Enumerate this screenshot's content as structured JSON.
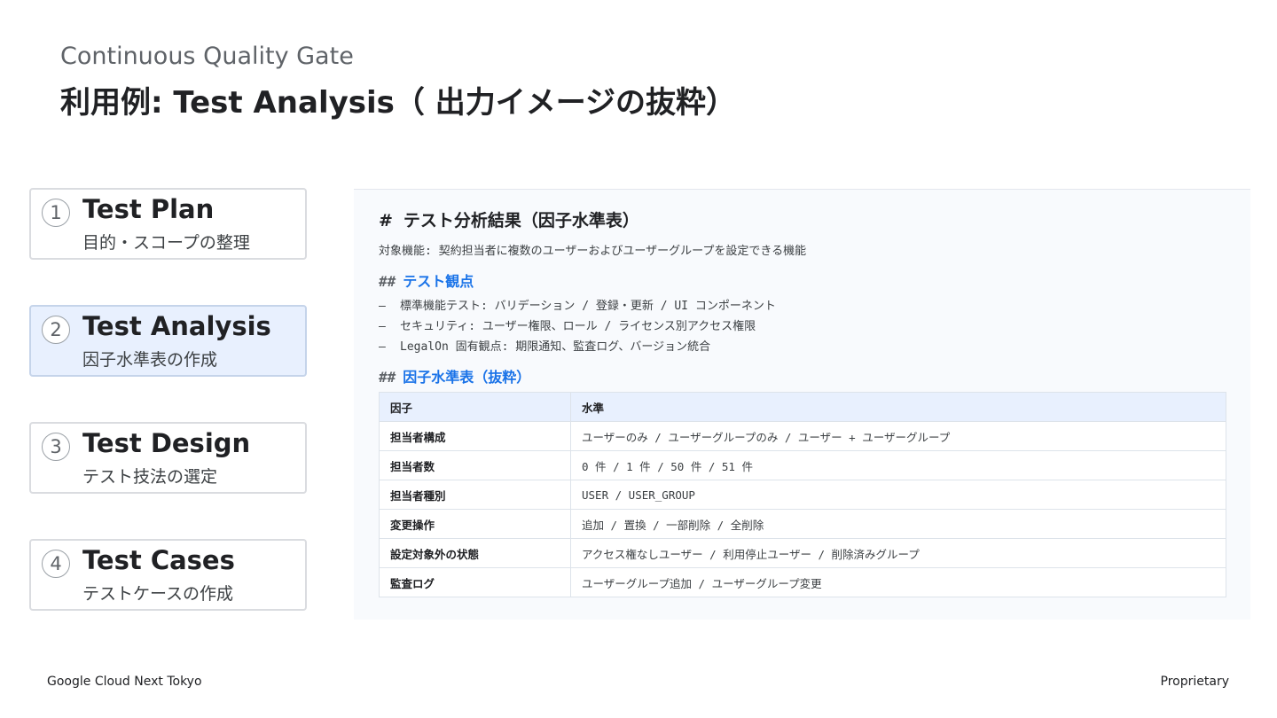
{
  "header": {
    "kicker": "Continuous Quality Gate",
    "title": "利用例: Test Analysis（ 出力イメージの抜粋）"
  },
  "steps": [
    {
      "num": "1",
      "title": "Test Plan",
      "subtitle": "目的・スコープの整理"
    },
    {
      "num": "2",
      "title": "Test Analysis",
      "subtitle": "因子水準表の作成"
    },
    {
      "num": "3",
      "title": "Test Design",
      "subtitle": "テスト技法の選定"
    },
    {
      "num": "4",
      "title": "Test Cases",
      "subtitle": "テストケースの作成"
    }
  ],
  "doc": {
    "h1_hash": "#",
    "h1": "テスト分析結果（因子水準表）",
    "target": "対象機能: 契約担当者に複数のユーザーおよびユーザーグループを設定できる機能",
    "h2_hash": "##",
    "section1": "テスト観点",
    "bullet_dash": "–",
    "bullets": [
      "標準機能テスト: バリデーション / 登録・更新 / UI コンポーネント",
      "セキュリティ: ユーザー権限、ロール / ライセンス別アクセス権限",
      "LegalOn 固有観点: 期限通知、監査ログ、バージョン統合"
    ],
    "section2": "因子水準表（抜粋）",
    "table": {
      "headers": [
        "因子",
        "水準"
      ],
      "rows": [
        [
          "担当者構成",
          "ユーザーのみ / ユーザーグループのみ / ユーザー + ユーザーグループ"
        ],
        [
          "担当者数",
          "0 件 / 1 件 / 50 件 / 51 件"
        ],
        [
          "担当者種別",
          "USER / USER_GROUP"
        ],
        [
          "変更操作",
          "追加 / 置換 / 一部削除 / 全削除"
        ],
        [
          "設定対象外の状態",
          "アクセス権なしユーザー / 利用停止ユーザー / 削除済みグループ"
        ],
        [
          "監査ログ",
          "ユーザーグループ追加 / ユーザーグループ変更"
        ]
      ]
    }
  },
  "footer": {
    "left": "Google Cloud Next Tokyo",
    "right": "Proprietary"
  },
  "colors": {
    "accent": "#1a73e8",
    "active_step_bg": "#e8f0fe",
    "border": "#dadce0"
  }
}
